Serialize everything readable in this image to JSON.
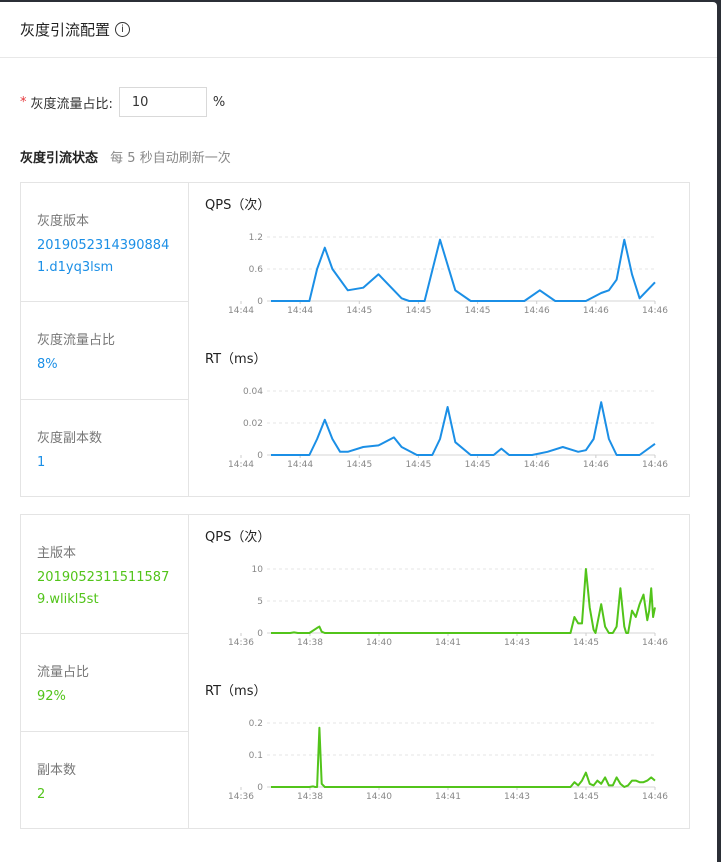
{
  "dialog": {
    "title": "灰度引流配置",
    "info_glyph": "i"
  },
  "form": {
    "required_mark": "*",
    "label": "灰度流量占比:",
    "value": "10",
    "unit": "%"
  },
  "status": {
    "label": "灰度引流状态",
    "hint": "每 5 秒自动刷新一次"
  },
  "colors": {
    "gray": "#1b8fe6",
    "main": "#52c41a"
  },
  "cards": [
    {
      "color": "gray",
      "rows": [
        {
          "key": "灰度版本",
          "value": "20190523143908841.d1yq3lsm"
        },
        {
          "key": "灰度流量占比",
          "value": "8%"
        },
        {
          "key": "灰度副本数",
          "value": "1"
        }
      ],
      "charts": [
        {
          "title": "QPS（次）"
        },
        {
          "title": "RT（ms）"
        }
      ]
    },
    {
      "color": "main",
      "rows": [
        {
          "key": "主版本",
          "value": "20190523115115879.wlikl5st"
        },
        {
          "key": "流量占比",
          "value": "92%"
        },
        {
          "key": "副本数",
          "value": "2"
        }
      ],
      "charts": [
        {
          "title": "QPS（次）"
        },
        {
          "title": "RT（ms）"
        }
      ]
    }
  ],
  "chart_data": [
    {
      "type": "line",
      "title": "QPS（次）",
      "color": "#1b8fe6",
      "yticks": [
        "0",
        "0.6",
        "1.2"
      ],
      "ylim": [
        0,
        1.2
      ],
      "xticks": [
        "14:44",
        "14:44",
        "14:45",
        "14:45",
        "14:45",
        "14:46",
        "14:46",
        "14:46"
      ],
      "x": [
        0,
        5,
        10,
        12,
        14,
        16,
        20,
        24,
        28,
        32,
        34,
        36,
        40,
        44,
        48,
        52,
        55,
        58,
        60,
        62,
        66,
        70,
        74,
        78,
        82,
        86,
        88,
        90,
        92,
        94,
        96,
        100
      ],
      "y": [
        0,
        0,
        0,
        0.6,
        1.0,
        0.6,
        0.2,
        0.25,
        0.5,
        0.2,
        0.05,
        0,
        0,
        1.15,
        0.2,
        0,
        0,
        0,
        0,
        0,
        0,
        0.2,
        0,
        0,
        0,
        0.15,
        0.2,
        0.4,
        1.15,
        0.5,
        0.05,
        0.35
      ]
    },
    {
      "type": "line",
      "title": "RT（ms）",
      "color": "#1b8fe6",
      "yticks": [
        "0",
        "0.02",
        "0.04"
      ],
      "ylim": [
        0,
        0.04
      ],
      "xticks": [
        "14:44",
        "14:44",
        "14:45",
        "14:45",
        "14:45",
        "14:46",
        "14:46",
        "14:46"
      ],
      "x": [
        0,
        5,
        10,
        12,
        14,
        16,
        18,
        20,
        24,
        28,
        32,
        34,
        38,
        42,
        44,
        46,
        48,
        52,
        56,
        58,
        60,
        62,
        64,
        68,
        72,
        76,
        80,
        82,
        84,
        86,
        88,
        90,
        92,
        96,
        100
      ],
      "y": [
        0,
        0,
        0,
        0.01,
        0.022,
        0.01,
        0.002,
        0.002,
        0.005,
        0.006,
        0.011,
        0.005,
        0,
        0,
        0.01,
        0.03,
        0.008,
        0,
        0,
        0,
        0.004,
        0,
        0,
        0,
        0.002,
        0.005,
        0.002,
        0.003,
        0.01,
        0.033,
        0.01,
        0,
        0,
        0,
        0.007
      ]
    },
    {
      "type": "line",
      "title": "QPS（次）",
      "color": "#52c41a",
      "yticks": [
        "0",
        "5",
        "10"
      ],
      "ylim": [
        0,
        10
      ],
      "xticks": [
        "14:36",
        "14:38",
        "14:40",
        "14:41",
        "14:43",
        "14:45",
        "14:46"
      ],
      "x": [
        0,
        5,
        6,
        7,
        8,
        10,
        12,
        12.6,
        13.2,
        14,
        20,
        40,
        60,
        75,
        78,
        79,
        80,
        81,
        82,
        83,
        84,
        84.5,
        85,
        86,
        87,
        88,
        88.5,
        89,
        90,
        91,
        92,
        92.5,
        93,
        94,
        95,
        96,
        97,
        98,
        98.5,
        99,
        99.5,
        100
      ],
      "y": [
        0,
        0,
        0.1,
        0,
        0,
        0,
        0.8,
        1.0,
        0.2,
        0,
        0,
        0,
        0,
        0,
        0,
        2.5,
        1.5,
        1.5,
        10,
        4,
        0.5,
        0,
        1.5,
        4.5,
        1,
        0,
        0,
        0,
        1,
        7,
        1,
        0,
        0,
        3.5,
        2.5,
        4.5,
        6.0,
        2,
        3.5,
        7.0,
        2.5,
        4.0
      ]
    },
    {
      "type": "line",
      "title": "RT（ms）",
      "color": "#52c41a",
      "yticks": [
        "0",
        "0.1",
        "0.2"
      ],
      "ylim": [
        0,
        0.2
      ],
      "xticks": [
        "14:36",
        "14:38",
        "14:40",
        "14:41",
        "14:43",
        "14:45",
        "14:46"
      ],
      "x": [
        0,
        5,
        10,
        11,
        11.5,
        12,
        12.6,
        13.2,
        14,
        20,
        40,
        60,
        75,
        78,
        79,
        80,
        81,
        82,
        83,
        84,
        85,
        86,
        87,
        88,
        89,
        90,
        91,
        92,
        93,
        94,
        95,
        96,
        97,
        98,
        99,
        100
      ],
      "y": [
        0,
        0,
        0,
        0.002,
        0,
        0,
        0.185,
        0.01,
        0,
        0,
        0,
        0,
        0,
        0,
        0.015,
        0.005,
        0.02,
        0.045,
        0.01,
        0.005,
        0.02,
        0.01,
        0.03,
        0.005,
        0.005,
        0.03,
        0.01,
        0,
        0.005,
        0.02,
        0.02,
        0.015,
        0.015,
        0.02,
        0.03,
        0.02
      ]
    }
  ]
}
